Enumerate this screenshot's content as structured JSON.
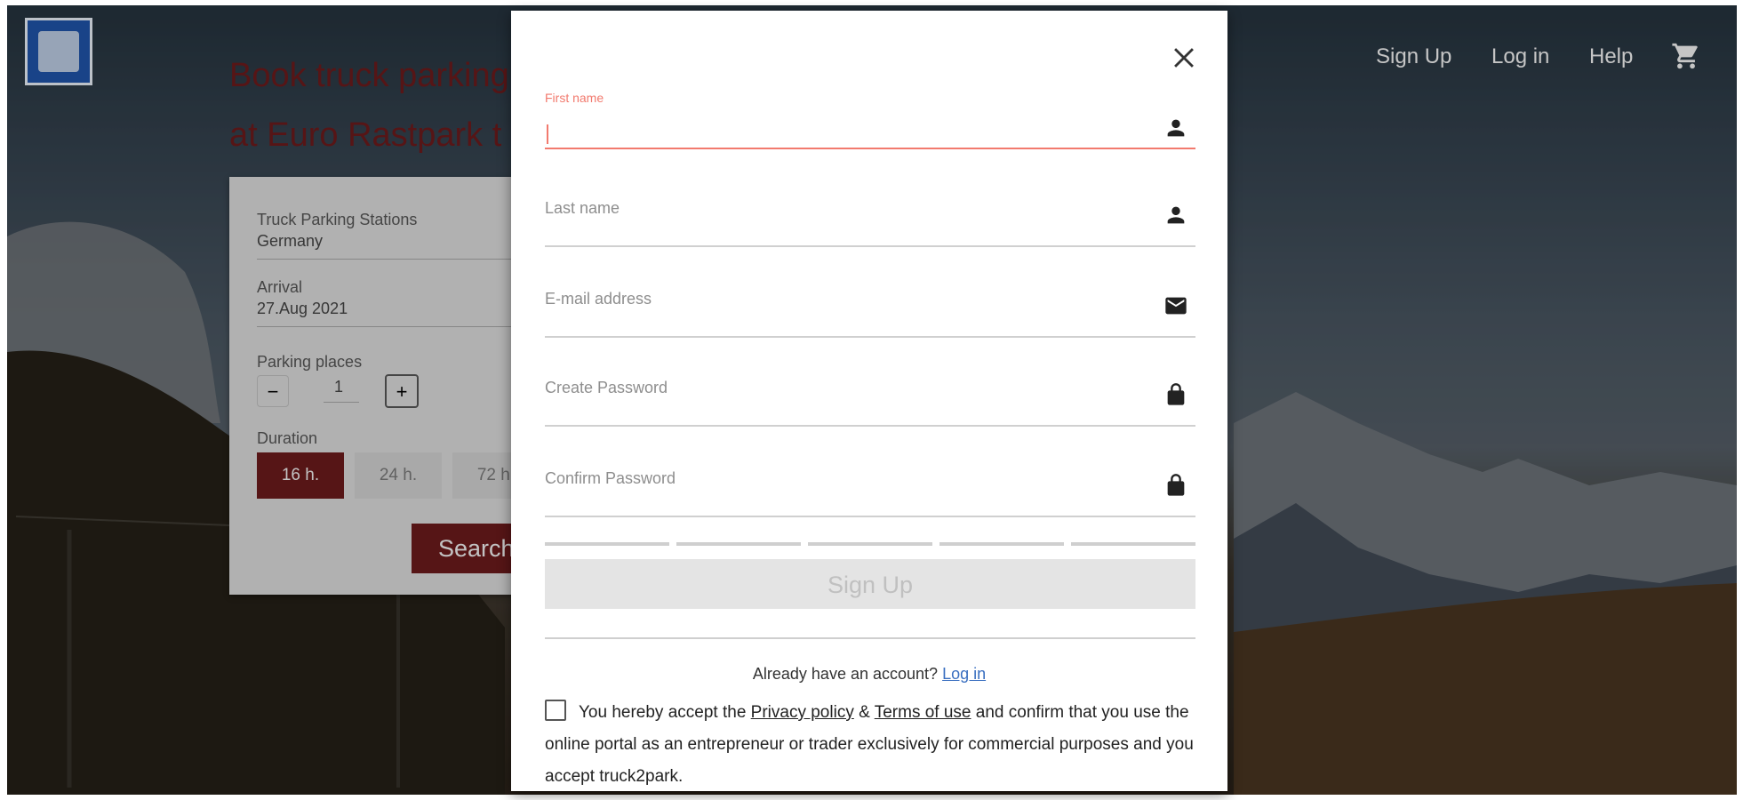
{
  "colors": {
    "brand_dark_red": "#6a1a1c",
    "field_active": "#f27a6e",
    "link_blue": "#3a6fc0",
    "logo_blue": "#1f52a6"
  },
  "header": {
    "nav": [
      "Sign Up",
      "Log in",
      "Help"
    ],
    "cart_icon": "shopping-cart-icon",
    "logo_icon": "truck2park-logo"
  },
  "hero": {
    "title_line1": "Book truck parking",
    "title_line2": "at Euro Rastpark t"
  },
  "search_card": {
    "station_label": "Truck Parking Stations",
    "station_value": "Germany",
    "arrival_label": "Arrival",
    "arrival_value": "27.Aug 2021",
    "places_label": "Parking places",
    "places_value": "1",
    "minus": "−",
    "plus": "+",
    "duration_label": "Duration",
    "durations": [
      "16 h.",
      "24 h.",
      "72 h."
    ],
    "selected_duration": "16 h.",
    "search_button": "Search"
  },
  "signup_modal": {
    "fields": [
      {
        "label": "First name",
        "value": "",
        "icon": "person-icon",
        "active": true
      },
      {
        "label": "Last name",
        "value": "",
        "icon": "person-icon"
      },
      {
        "label": "E-mail address",
        "value": "",
        "icon": "mail-icon"
      },
      {
        "label": "Create Password",
        "value": "",
        "icon": "lock-icon"
      },
      {
        "label": "Confirm Password",
        "value": "",
        "icon": "lock-icon"
      }
    ],
    "submit_label": "Sign Up",
    "already_text": "Already have an account?",
    "login_link": "Log in",
    "consent_part1": "You hereby accept the",
    "privacy_link": "Privacy policy",
    "amp": "&",
    "terms_link": "Terms of use",
    "consent_part2": "and confirm that you use the online portal as an entrepreneur or trader exclusively for commercial purposes and you accept truck2park."
  }
}
